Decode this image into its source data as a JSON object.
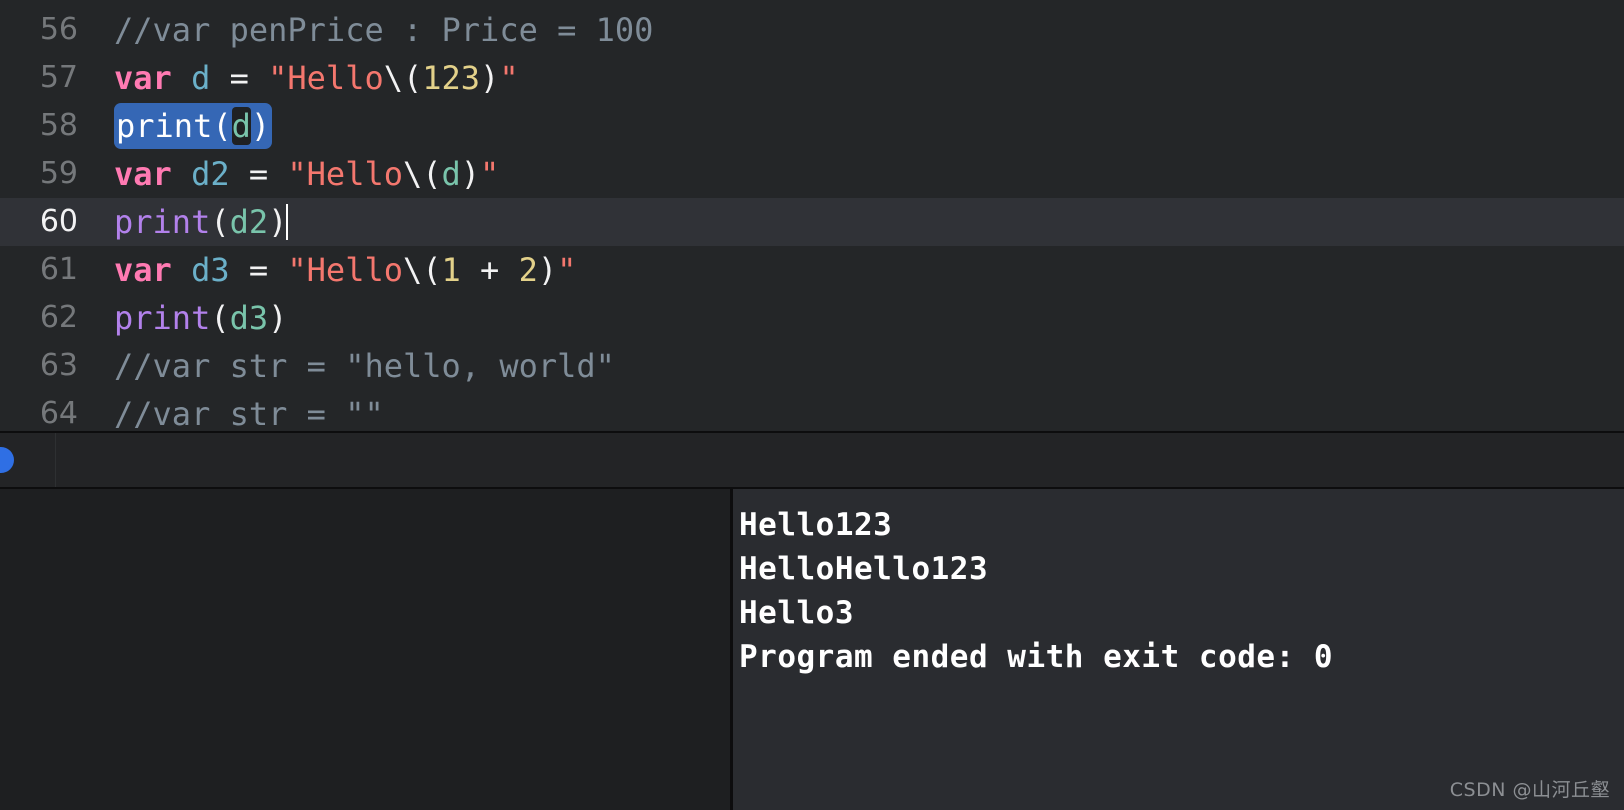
{
  "editor": {
    "lines": [
      {
        "number": "56",
        "active": false,
        "tokens": [
          {
            "text": "//var penPrice : Price = 100",
            "kind": "comment"
          }
        ]
      },
      {
        "number": "57",
        "active": false,
        "tokens": [
          {
            "text": "var",
            "kind": "keyword"
          },
          {
            "text": " ",
            "kind": "plain"
          },
          {
            "text": "d",
            "kind": "decl"
          },
          {
            "text": " ",
            "kind": "plain"
          },
          {
            "text": "=",
            "kind": "plain"
          },
          {
            "text": " ",
            "kind": "plain"
          },
          {
            "text": "\"Hello",
            "kind": "string"
          },
          {
            "text": "\\(",
            "kind": "plain"
          },
          {
            "text": "123",
            "kind": "number"
          },
          {
            "text": ")",
            "kind": "plain"
          },
          {
            "text": "\"",
            "kind": "string"
          }
        ]
      },
      {
        "number": "58",
        "active": false,
        "selected": true,
        "tokens": [
          {
            "text": "print",
            "kind": "func"
          },
          {
            "text": "(",
            "kind": "plain"
          },
          {
            "text": "d",
            "kind": "var"
          },
          {
            "text": ")",
            "kind": "plain"
          }
        ]
      },
      {
        "number": "59",
        "active": false,
        "tokens": [
          {
            "text": "var",
            "kind": "keyword"
          },
          {
            "text": " ",
            "kind": "plain"
          },
          {
            "text": "d2",
            "kind": "decl"
          },
          {
            "text": " ",
            "kind": "plain"
          },
          {
            "text": "=",
            "kind": "plain"
          },
          {
            "text": " ",
            "kind": "plain"
          },
          {
            "text": "\"Hello",
            "kind": "string"
          },
          {
            "text": "\\(",
            "kind": "plain"
          },
          {
            "text": "d",
            "kind": "var"
          },
          {
            "text": ")",
            "kind": "plain"
          },
          {
            "text": "\"",
            "kind": "string"
          }
        ]
      },
      {
        "number": "60",
        "active": true,
        "caret": true,
        "tokens": [
          {
            "text": "print",
            "kind": "func"
          },
          {
            "text": "(",
            "kind": "plain"
          },
          {
            "text": "d2",
            "kind": "var"
          },
          {
            "text": ")",
            "kind": "plain"
          }
        ]
      },
      {
        "number": "61",
        "active": false,
        "tokens": [
          {
            "text": "var",
            "kind": "keyword"
          },
          {
            "text": " ",
            "kind": "plain"
          },
          {
            "text": "d3",
            "kind": "decl"
          },
          {
            "text": " ",
            "kind": "plain"
          },
          {
            "text": "=",
            "kind": "plain"
          },
          {
            "text": " ",
            "kind": "plain"
          },
          {
            "text": "\"Hello",
            "kind": "string"
          },
          {
            "text": "\\(",
            "kind": "plain"
          },
          {
            "text": "1",
            "kind": "number"
          },
          {
            "text": " + ",
            "kind": "plain"
          },
          {
            "text": "2",
            "kind": "number"
          },
          {
            "text": ")",
            "kind": "plain"
          },
          {
            "text": "\"",
            "kind": "string"
          }
        ]
      },
      {
        "number": "62",
        "active": false,
        "tokens": [
          {
            "text": "print",
            "kind": "func"
          },
          {
            "text": "(",
            "kind": "plain"
          },
          {
            "text": "d3",
            "kind": "var"
          },
          {
            "text": ")",
            "kind": "plain"
          }
        ]
      },
      {
        "number": "63",
        "active": false,
        "tokens": [
          {
            "text": "//var str = \"hello, world\"",
            "kind": "comment"
          }
        ]
      },
      {
        "number": "64",
        "active": false,
        "tokens": [
          {
            "text": "//var str = \"\"",
            "kind": "comment"
          }
        ]
      }
    ]
  },
  "debug_bar": {
    "indicator": "blue-dot"
  },
  "console": {
    "lines": [
      "Hello123",
      "HelloHello123",
      "Hello3",
      "Program ended with exit code: 0"
    ]
  },
  "watermark": {
    "text": "CSDN @山河丘壑"
  },
  "colors": {
    "editor_background": "#242628",
    "active_line_background": "#303237",
    "selection_background": "#3567b5",
    "console_background": "#2a2c30",
    "variables_pane_background": "#1e1f21",
    "keyword": "#ff7ab2",
    "string": "#f4776e",
    "number": "#e3d18a",
    "function": "#b281eb",
    "variable": "#79c4ab",
    "declaration": "#6bb0c9",
    "comment": "#7f8c98",
    "plain_text": "#f2f2f3",
    "blue_indicator": "#2f6fe4"
  }
}
